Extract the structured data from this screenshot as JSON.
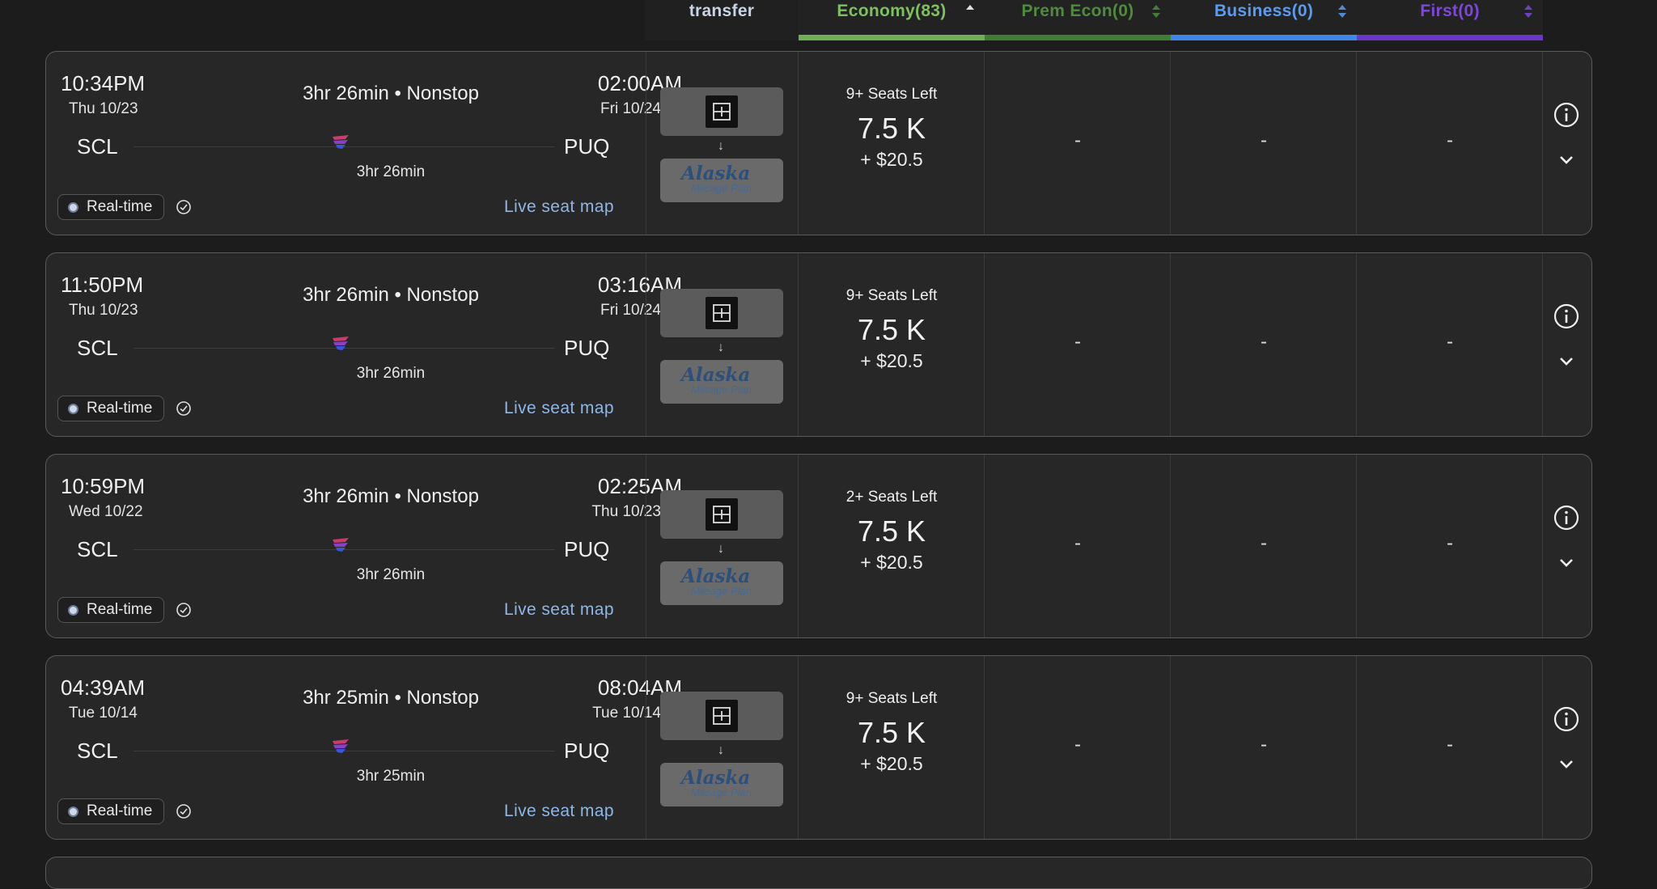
{
  "header": {
    "transfer": "transfer",
    "economy": "Economy(83)",
    "prem_econ": "Prem Econ(0)",
    "business": "Business(0)",
    "first": "First(0)"
  },
  "colors": {
    "economy": "#6fae56",
    "prem_econ": "#3f7d35",
    "business": "#3f86ea",
    "first": "#6b37c8",
    "link": "#8fb6e6"
  },
  "flights": [
    {
      "dep_time": "10:34PM",
      "dep_date": "Thu 10/23",
      "summary": "3hr 26min • Nonstop",
      "arr_time": "02:00AM",
      "arr_date": "Fri 10/24",
      "origin": "SCL",
      "destination": "PUQ",
      "duration": "3hr 26min",
      "realtime_label": "Real-time",
      "seat_map_label": "Live seat map",
      "program": "Alaska",
      "program_sub": "Mileage Plan",
      "arrow": "↓",
      "economy": {
        "seats": "9+ Seats Left",
        "miles": "7.5 K",
        "fee": "+ $20.5"
      },
      "prem_econ": "-",
      "business": "-",
      "first": "-"
    },
    {
      "dep_time": "11:50PM",
      "dep_date": "Thu 10/23",
      "summary": "3hr 26min • Nonstop",
      "arr_time": "03:16AM",
      "arr_date": "Fri 10/24",
      "origin": "SCL",
      "destination": "PUQ",
      "duration": "3hr 26min",
      "realtime_label": "Real-time",
      "seat_map_label": "Live seat map",
      "program": "Alaska",
      "program_sub": "Mileage Plan",
      "arrow": "↓",
      "economy": {
        "seats": "9+ Seats Left",
        "miles": "7.5 K",
        "fee": "+ $20.5"
      },
      "prem_econ": "-",
      "business": "-",
      "first": "-"
    },
    {
      "dep_time": "10:59PM",
      "dep_date": "Wed 10/22",
      "summary": "3hr 26min • Nonstop",
      "arr_time": "02:25AM",
      "arr_date": "Thu 10/23",
      "origin": "SCL",
      "destination": "PUQ",
      "duration": "3hr 26min",
      "realtime_label": "Real-time",
      "seat_map_label": "Live seat map",
      "program": "Alaska",
      "program_sub": "Mileage Plan",
      "arrow": "↓",
      "economy": {
        "seats": "2+ Seats Left",
        "miles": "7.5 K",
        "fee": "+ $20.5"
      },
      "prem_econ": "-",
      "business": "-",
      "first": "-"
    },
    {
      "dep_time": "04:39AM",
      "dep_date": "Tue 10/14",
      "summary": "3hr 25min • Nonstop",
      "arr_time": "08:04AM",
      "arr_date": "Tue 10/14",
      "origin": "SCL",
      "destination": "PUQ",
      "duration": "3hr 25min",
      "realtime_label": "Real-time",
      "seat_map_label": "Live seat map",
      "program": "Alaska",
      "program_sub": "Mileage Plan",
      "arrow": "↓",
      "economy": {
        "seats": "9+ Seats Left",
        "miles": "7.5 K",
        "fee": "+ $20.5"
      },
      "prem_econ": "-",
      "business": "-",
      "first": "-"
    }
  ]
}
